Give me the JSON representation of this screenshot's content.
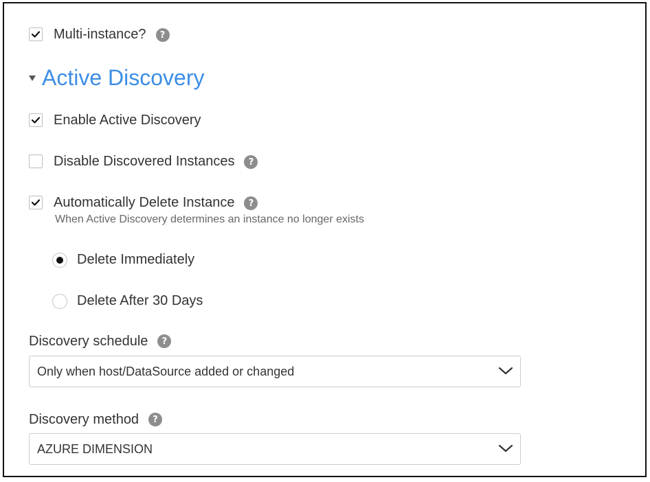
{
  "multi_instance": {
    "label": "Multi-instance?",
    "checked": true,
    "help_icon": "help-circle-icon"
  },
  "active_discovery": {
    "title": "Active Discovery",
    "expanded": true,
    "enable": {
      "label": "Enable Active Discovery",
      "checked": true
    },
    "disable_discovered": {
      "label": "Disable Discovered Instances",
      "checked": false,
      "help_icon": "help-circle-icon"
    },
    "auto_delete": {
      "label": "Automatically Delete Instance",
      "checked": true,
      "help_icon": "help-circle-icon",
      "description": "When Active Discovery determines an instance no longer exists"
    },
    "delete_options": [
      {
        "label": "Delete Immediately",
        "selected": true
      },
      {
        "label": "Delete After 30 Days",
        "selected": false
      }
    ]
  },
  "schedule": {
    "label": "Discovery schedule",
    "value": "Only when host/DataSource added or changed"
  },
  "method": {
    "label": "Discovery method",
    "value": "AZURE DIMENSION"
  },
  "help_glyph": "?",
  "colors": {
    "accent": "#3d8ee5",
    "help": "#8d8d8d",
    "text": "#333333"
  }
}
